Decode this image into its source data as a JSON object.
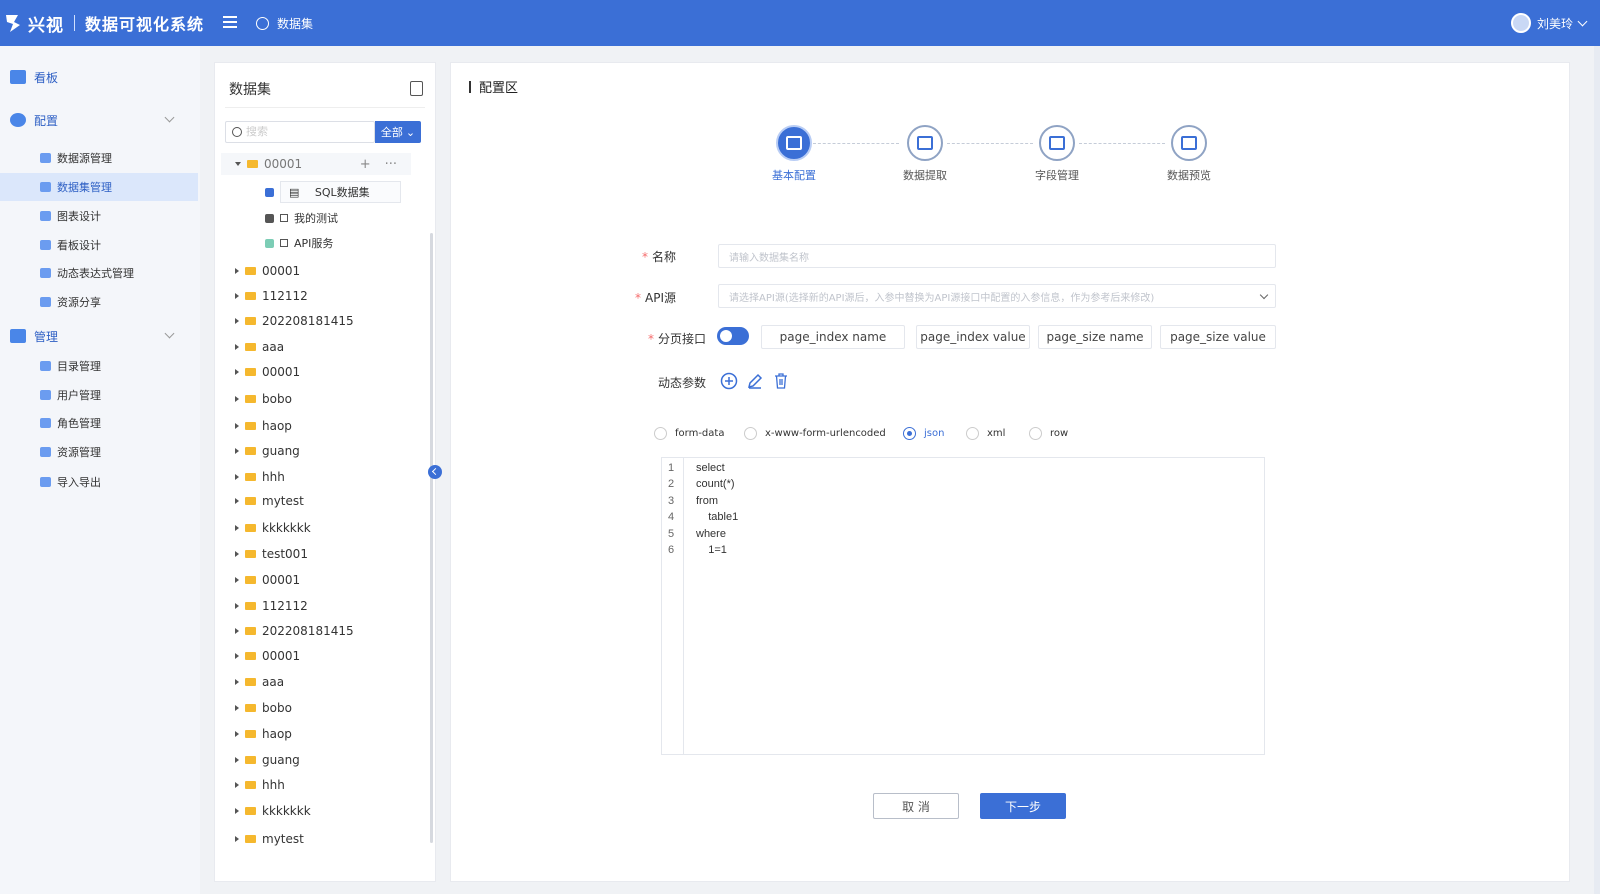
{
  "header": {
    "brand": "兴视",
    "system_title": "数据可视化系统",
    "breadcrumb": "数据集",
    "user_name": "刘美玲"
  },
  "sidebar": {
    "groups": [
      {
        "label": "看板",
        "icon": "dashboard-icon"
      },
      {
        "label": "配置",
        "icon": "gear-icon"
      },
      {
        "label": "管理",
        "icon": "manage-icon"
      }
    ],
    "config_items": [
      "数据源管理",
      "数据集管理",
      "图表设计",
      "看板设计",
      "动态表达式管理",
      "资源分享"
    ],
    "manage_items": [
      "目录管理",
      "用户管理",
      "角色管理",
      "资源管理",
      "导入导出"
    ],
    "active_item": "数据集管理"
  },
  "tree": {
    "title": "数据集",
    "search_placeholder": "搜索",
    "filter_label": "全部",
    "root": "00001",
    "children": [
      "SQL数据集",
      "我的测试",
      "API服务"
    ],
    "folders": [
      "00001",
      "112112",
      "202208181415",
      "aaa",
      "00001",
      "bobo",
      "haop",
      "guang",
      "hhh",
      "mytest",
      "kkkkkkk",
      "test001",
      "00001",
      "112112",
      "202208181415",
      "00001",
      "aaa",
      "bobo",
      "haop",
      "guang",
      "hhh",
      "kkkkkkk",
      "mytest"
    ]
  },
  "main": {
    "section_title": "配置区",
    "steps": [
      "基本配置",
      "数据提取",
      "字段管理",
      "数据预览"
    ],
    "active_step": 0,
    "form": {
      "name_label": "名称",
      "name_placeholder": "请输入数据集名称",
      "api_label": "API源",
      "api_placeholder": "请选择API源(选择新的API源后，入参中替换为API源接口中配置的入参信息，作为参考后来修改)",
      "paging_label": "分页接口",
      "paging_enabled": true,
      "paging_fields": [
        "page_index name",
        "page_index value",
        "page_size name",
        "page_size value"
      ],
      "dynamic_params_label": "动态参数"
    },
    "body_types": [
      "form-data",
      "x-www-form-urlencoded",
      "json",
      "xml",
      "row"
    ],
    "selected_body_type": "json",
    "editor_lines": [
      {
        "n": "1",
        "text": "select"
      },
      {
        "n": "2",
        "text": "count(*)"
      },
      {
        "n": "3",
        "text": "from"
      },
      {
        "n": "4",
        "text": "    table1"
      },
      {
        "n": "5",
        "text": "where"
      },
      {
        "n": "6",
        "text": "    1=1"
      }
    ],
    "cancel_label": "取 消",
    "next_label": "下一步"
  },
  "colors": {
    "primary": "#3b6fd6",
    "required": "#f56c6c",
    "folder": "#f5b82e"
  }
}
